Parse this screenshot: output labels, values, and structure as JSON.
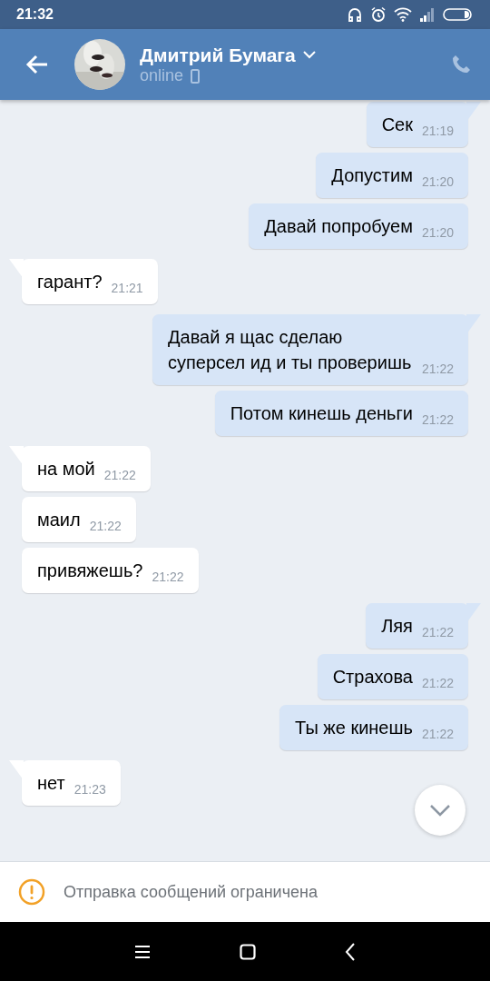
{
  "status_bar": {
    "time": "21:32"
  },
  "header": {
    "name": "Дмитрий Бумага",
    "status": "online"
  },
  "groups": [
    {
      "kind": "outgoing",
      "messages": [
        {
          "text": "Сек",
          "time": "21:19"
        },
        {
          "text": "Допустим",
          "time": "21:20"
        },
        {
          "text": "Давай попробуем",
          "time": "21:20"
        }
      ]
    },
    {
      "kind": "incoming",
      "messages": [
        {
          "text": "гарант?",
          "time": "21:21"
        }
      ]
    },
    {
      "kind": "outgoing",
      "messages": [
        {
          "text": "Давай я щас сделаю суперсел ид и ты проверишь",
          "time": "21:22"
        },
        {
          "text": "Потом кинешь деньги",
          "time": "21:22"
        }
      ]
    },
    {
      "kind": "incoming",
      "messages": [
        {
          "text": "на мой",
          "time": "21:22"
        },
        {
          "text": "маил",
          "time": "21:22"
        },
        {
          "text": "привяжешь?",
          "time": "21:22"
        }
      ]
    },
    {
      "kind": "outgoing",
      "messages": [
        {
          "text": "Ляя",
          "time": "21:22"
        },
        {
          "text": "Страхова",
          "time": "21:22"
        },
        {
          "text": "Ты же кинешь",
          "time": "21:22"
        }
      ]
    },
    {
      "kind": "incoming",
      "messages": [
        {
          "text": "нет",
          "time": "21:23"
        }
      ]
    }
  ],
  "notice": {
    "text": "Отправка сообщений ограничена"
  }
}
